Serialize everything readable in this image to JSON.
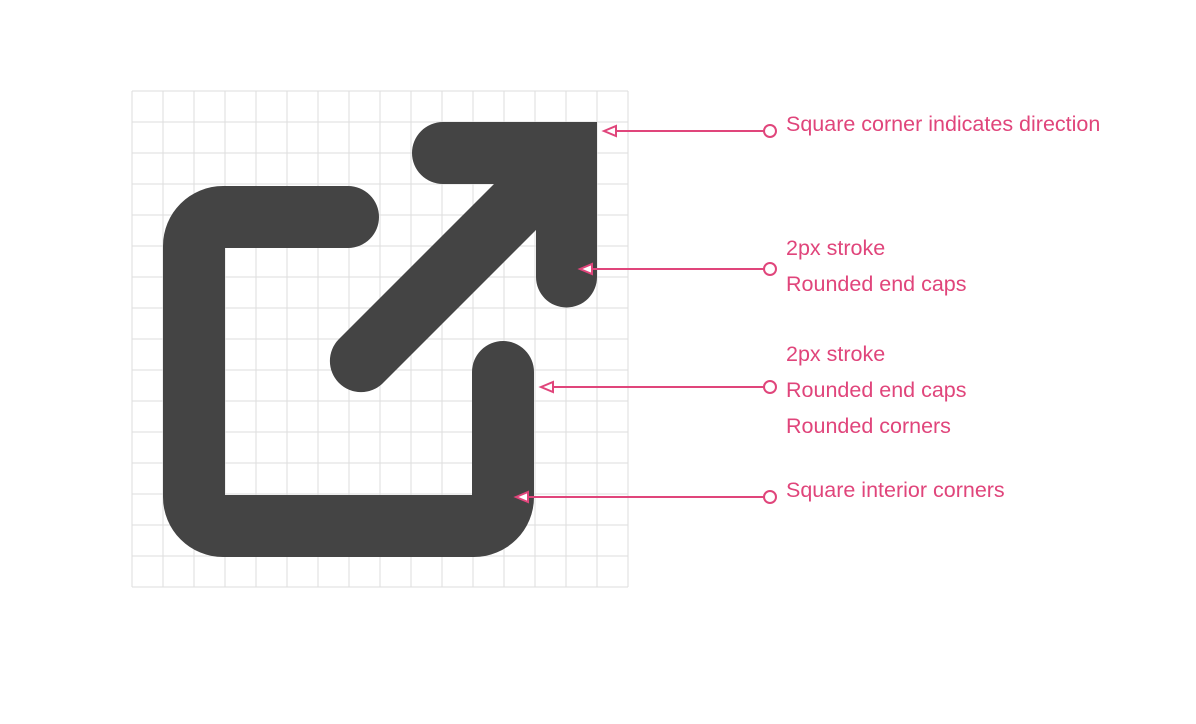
{
  "colors": {
    "background": "#ffffff",
    "grid": "#dddddd",
    "icon": "#444444",
    "accent": "#e0457b"
  },
  "icon": {
    "name": "open-in-new-icon"
  },
  "annotations": [
    {
      "lines": [
        "Square corner indicates direction"
      ]
    },
    {
      "lines": [
        "2px stroke",
        "Rounded end caps"
      ]
    },
    {
      "lines": [
        "2px stroke",
        "Rounded end caps",
        "Rounded corners"
      ]
    },
    {
      "lines": [
        "Square interior corners"
      ]
    }
  ]
}
